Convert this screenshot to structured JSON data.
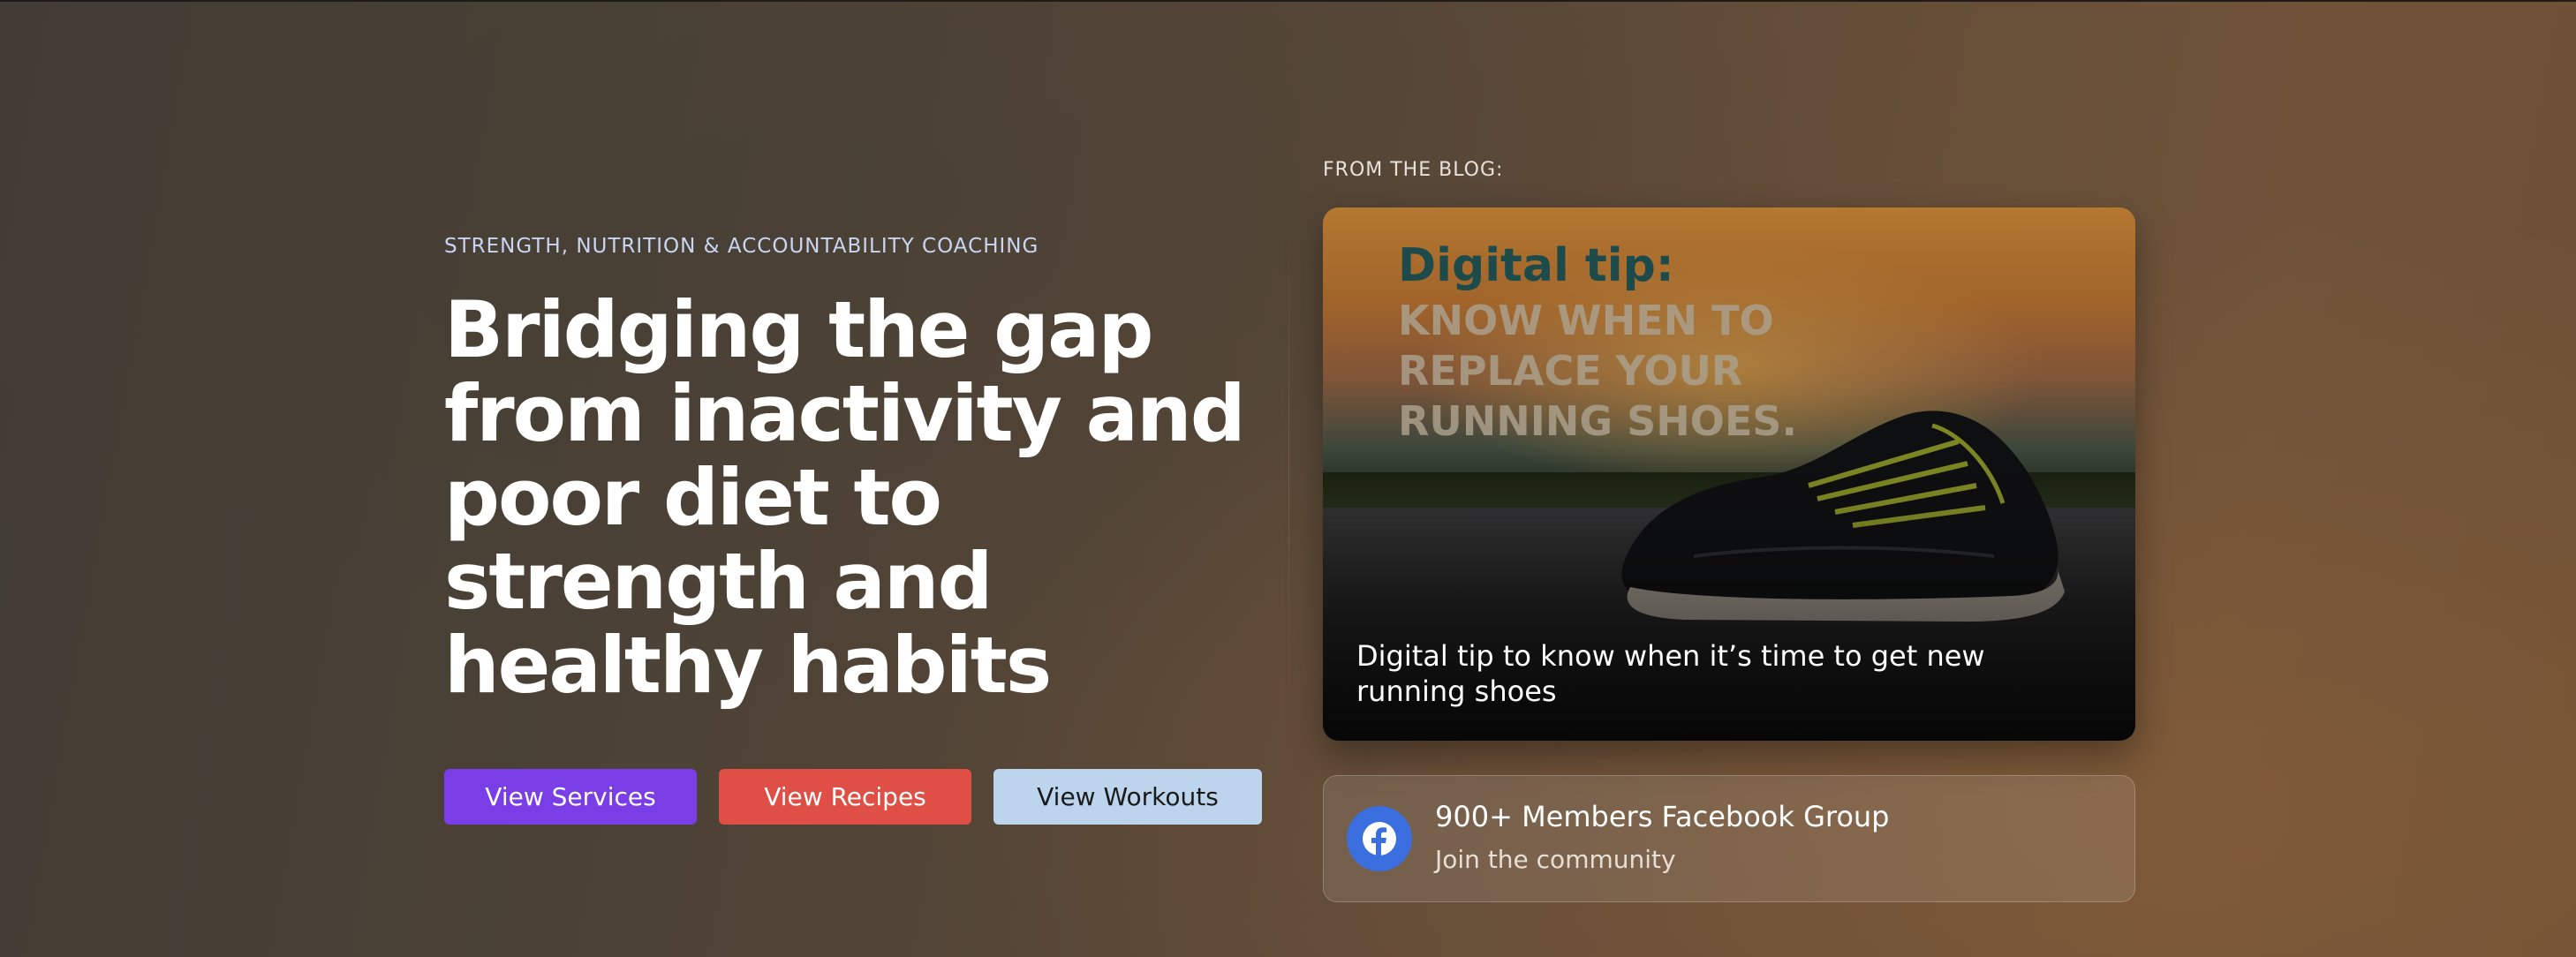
{
  "hero": {
    "eyebrow": "STRENGTH, NUTRITION & ACCOUNTABILITY COACHING",
    "headline_lines": [
      "Bridging the gap",
      "from inactivity and",
      "poor diet to",
      "strength and",
      "healthy habits"
    ],
    "buttons": {
      "services": "View Services",
      "recipes": "View Recipes",
      "workouts": "View Workouts"
    }
  },
  "blog": {
    "label": "FROM THE BLOG:",
    "image_title": "Digital tip:",
    "image_sub_lines": [
      "KNOW WHEN TO",
      "REPLACE YOUR",
      "RUNNING SHOES."
    ],
    "caption": "Digital tip to know when it’s time to get new running shoes"
  },
  "community": {
    "title": "900+ Members Facebook Group",
    "subtitle": "Join the community",
    "icon": "facebook-icon"
  },
  "colors": {
    "services_button": "#7a3ee6",
    "recipes_button": "#df4f45",
    "workouts_button": "#bcd5ec",
    "eyebrow": "#c8d6f2",
    "facebook": "#3b6fe0"
  }
}
